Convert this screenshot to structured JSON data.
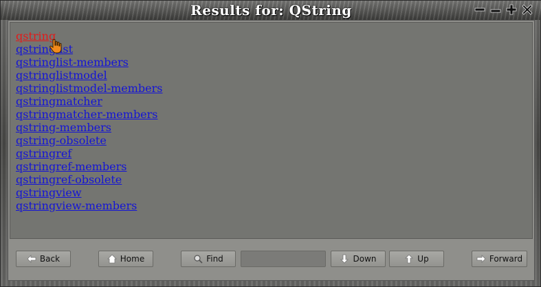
{
  "window": {
    "title": "Results for: QString",
    "controls": [
      "minimize-icon",
      "shade-icon",
      "maximize-icon",
      "close-icon"
    ]
  },
  "results": [
    {
      "label": "qstring",
      "active": true
    },
    {
      "label": "qstringlist"
    },
    {
      "label": "qstringlist-members"
    },
    {
      "label": "qstringlistmodel"
    },
    {
      "label": "qstringlistmodel-members"
    },
    {
      "label": "qstringmatcher"
    },
    {
      "label": "qstringmatcher-members"
    },
    {
      "label": "qstring-members"
    },
    {
      "label": "qstring-obsolete"
    },
    {
      "label": "qstringref"
    },
    {
      "label": "qstringref-members"
    },
    {
      "label": "qstringref-obsolete"
    },
    {
      "label": "qstringview"
    },
    {
      "label": "qstringview-members"
    }
  ],
  "toolbar": {
    "back_label": "Back",
    "home_label": "Home",
    "find_label": "Find",
    "find_value": "",
    "down_label": "Down",
    "up_label": "Up",
    "forward_label": "Forward"
  },
  "colors": {
    "link": "#1414d6",
    "active_link": "#e31a1a",
    "results_bg": "#747571"
  }
}
